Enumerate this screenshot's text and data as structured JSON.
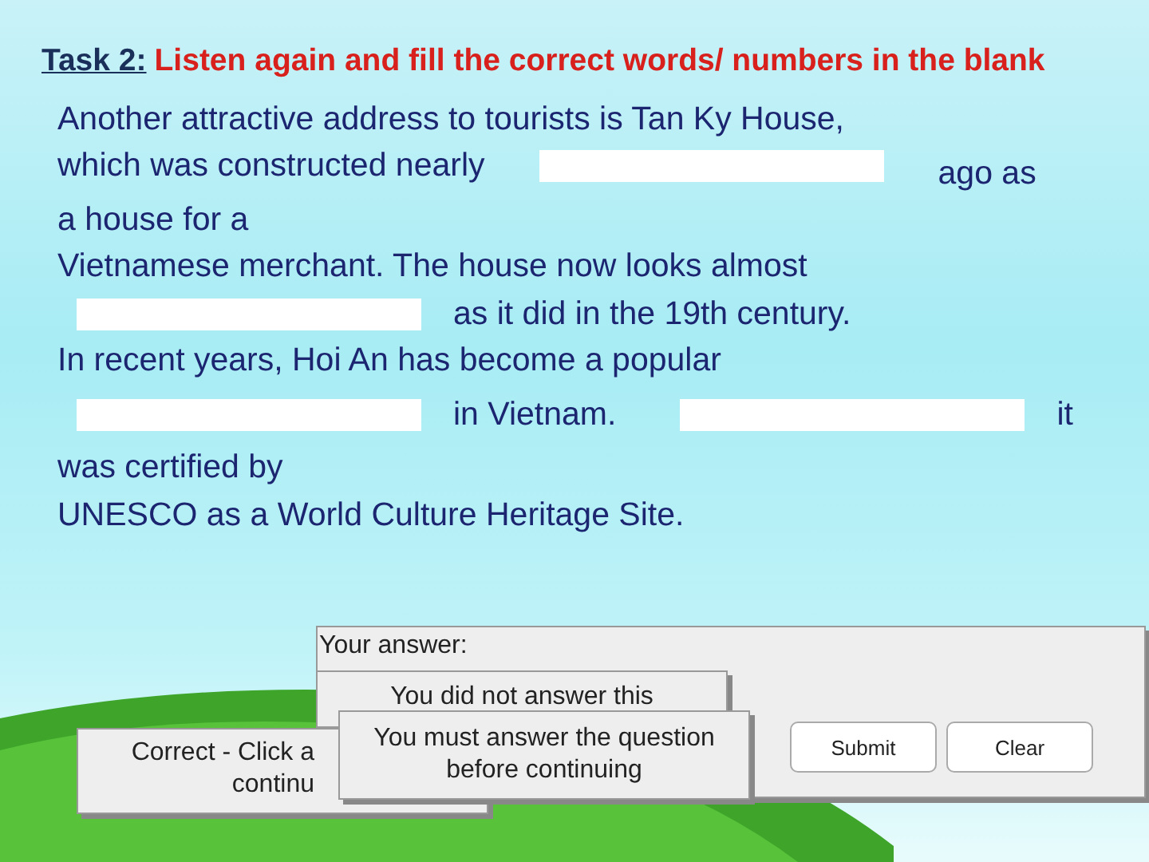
{
  "task": {
    "label": "Task 2:",
    "instruction": "Listen again and fill the correct words/ numbers in the blank"
  },
  "passage": [
    [
      {
        "kind": "text",
        "text": "Another attractive address to tourists is Tan Ky House,"
      }
    ],
    [
      {
        "kind": "text",
        "text": "which was constructed nearly"
      },
      {
        "kind": "blank"
      },
      {
        "kind": "text",
        "text": "ago as"
      }
    ],
    [
      {
        "kind": "text",
        "text": "a house for a"
      }
    ],
    [
      {
        "kind": "text",
        "text": "Vietnamese merchant. The house now looks almost"
      }
    ],
    [
      {
        "kind": "blank"
      },
      {
        "kind": "text",
        "text": "as it did in the 19th century."
      }
    ],
    [
      {
        "kind": "text",
        "text": "In recent years, Hoi An has become a popular"
      }
    ],
    [
      {
        "kind": "blank"
      },
      {
        "kind": "text",
        "text": "in Vietnam."
      },
      {
        "kind": "blank"
      },
      {
        "kind": "text",
        "text": "it"
      }
    ],
    [
      {
        "kind": "text",
        "text": "was certified by"
      }
    ],
    [
      {
        "kind": "text",
        "text": "UNESCO as a World Culture Heritage Site."
      }
    ]
  ],
  "answer_panel": {
    "label": "Your answer:",
    "buttons": [
      "Submit",
      "Clear"
    ]
  },
  "popups": [
    {
      "kind": "notice",
      "lines": [
        "You did not answer this"
      ]
    },
    {
      "kind": "correct",
      "lines": [
        "Correct - Click a",
        "continu"
      ]
    },
    {
      "kind": "warning",
      "lines": [
        "You must answer the question",
        "before continuing"
      ]
    }
  ]
}
